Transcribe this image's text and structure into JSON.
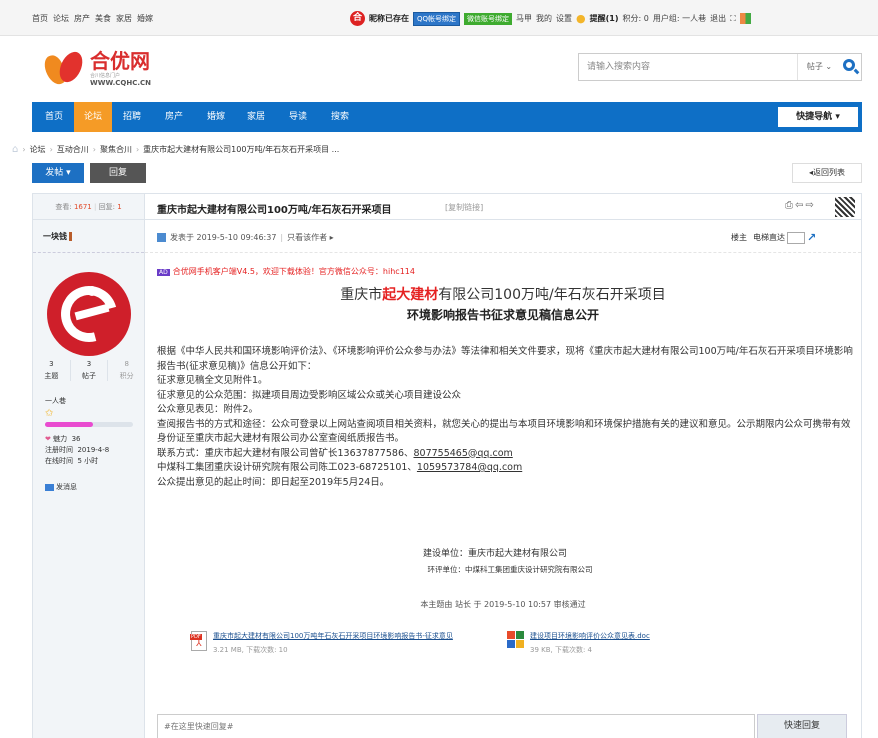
{
  "topbar": {
    "links": [
      "首页",
      "论坛",
      "房产",
      "美食",
      "家居",
      "婚嫁"
    ],
    "logo_glyph": "合",
    "nickname": "昵称已存在",
    "qq_bind": "QQ帐号绑定",
    "wx_bind": "微信账号绑定",
    "user": "马甲",
    "my": "我的",
    "settings": "设置",
    "reminder": "提醒(1)",
    "points": "积分: 0",
    "usergroup": "用户组: 一人巷",
    "logout": "退出"
  },
  "header": {
    "logo_cn": "合优网",
    "logo_sub": "合川信息门户",
    "logo_url": "WWW.CQHC.CN",
    "search_placeholder": "请输入搜索内容",
    "search_type": "帖子"
  },
  "nav": {
    "items": [
      "首页",
      "论坛",
      "招聘",
      "房产",
      "婚嫁",
      "家居",
      "导读",
      "搜索"
    ],
    "quick_nav": "快捷导航"
  },
  "breadcrumb": [
    "论坛",
    "互动合川",
    "聚焦合川",
    "重庆市起大建材有限公司100万吨/年石灰石开采项目 ..."
  ],
  "toolbar": {
    "post": "发帖",
    "reply": "回复",
    "back": "返回列表"
  },
  "thread": {
    "views_label": "查看:",
    "views": "1671",
    "replies_label": "回复:",
    "replies": "1",
    "title": "重庆市起大建材有限公司100万吨/年石灰石开采项目",
    "copy_link": "[复制链接]",
    "posted": "发表于 2019-5-10 09:46:37",
    "author_only": "只看该作者",
    "floor_owner": "楼主",
    "floor_jump": "电梯直达"
  },
  "author": {
    "name": "一块钱",
    "counts": [
      {
        "value": "3",
        "label": "主题"
      },
      {
        "value": "3",
        "label": "帖子"
      },
      {
        "value": "8",
        "label": "积分"
      }
    ],
    "group": "一人巷",
    "level_fill_pct": 55,
    "charm_label": "魅力",
    "charm": "36",
    "reg_label": "注册时间",
    "reg": "2019-4-8",
    "online_label": "在线时间",
    "online": "5 小时",
    "pm": "发消息"
  },
  "post": {
    "promo": "合优网手机客户端V4.5，欢迎下载体验！官方微信公众号：hihc114",
    "h1_pre": "重庆市",
    "h1_red": "起大建材",
    "h1_post": "有限公司100万吨/年石灰石开采项目",
    "h2": "环境影响报告书征求意见稿信息公开",
    "p1": "根据《中华人民共和国环境影响评价法》、《环境影响评价公众参与办法》等法律和相关文件要求，现将《重庆市起大建材有限公司100万吨/年石灰石开采项目环境影响报告书(征求意见稿)》信息公开如下：",
    "p2": "征求意见稿全文见附件1。",
    "p3": "征求意见的公众范围：拟建项目周边受影响区域公众或关心项目建设公众",
    "p4": "公众意见表见：附件2。",
    "p5": "查阅报告书的方式和途径：公众可登录以上网站查阅项目相关资料，就您关心的提出与本项目环境影响和环境保护措施有关的建议和意见。公示期限内公众可携带有效身份证至重庆市起大建材有限公司办公室查阅纸质报告书。",
    "p6_pre": "联系方式：重庆市起大建材有限公司曾矿长13637877586、",
    "p6_link": "807755465@qq.com",
    "p7_pre": "中煤科工集团重庆设计研究院有限公司陈工023-68725101、",
    "p7_link": "1059573784@qq.com",
    "p8": "公众提出意见的起止时间：即日起至2019年5月24日。",
    "sig1": "建设单位：重庆市起大建材有限公司",
    "sig2": "环评单位：中煤科工集团重庆设计研究院有限公司",
    "review": "本主题由 站长 于 2019-5-10 10:57 审核通过"
  },
  "attachments": [
    {
      "icon": "pdf-icon",
      "name": "重庆市起大建材有限公司100万吨年石灰石开采项目环境影响报告书-征求意见",
      "meta": "3.21 MB, 下载次数: 10"
    },
    {
      "icon": "doc-icon",
      "name": "建设项目环境影响评价公众意见表.doc",
      "meta": "39 KB, 下载次数: 4"
    }
  ],
  "reply": {
    "placeholder": "#在这里快速回复#",
    "button": "快速回复"
  },
  "colors": {
    "nav_blue": "#0e6fc6",
    "nav_active": "#f59b26",
    "red": "#e52222"
  }
}
